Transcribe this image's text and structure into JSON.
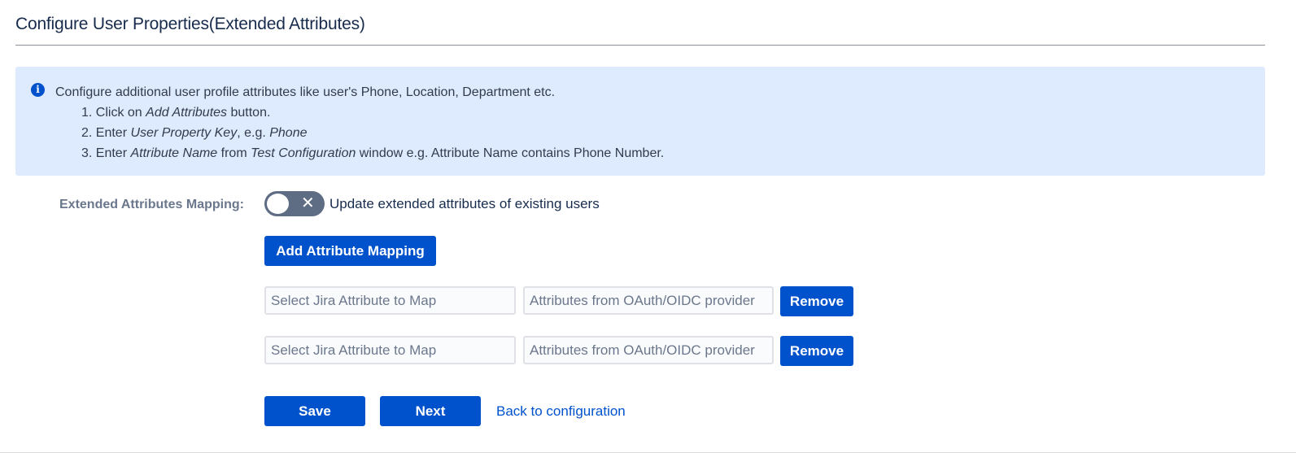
{
  "header": {
    "title": "Configure User Properties(Extended Attributes)"
  },
  "info": {
    "icon": "info-icon",
    "intro": "Configure additional user profile attributes like user's Phone, Location, Department etc.",
    "steps": [
      {
        "prefix": "1. Click on ",
        "em1": "Add Attributes",
        "mid": " button.",
        "em2": "",
        "suffix": ""
      },
      {
        "prefix": "2. Enter ",
        "em1": "User Property Key",
        "mid": ", e.g. ",
        "em2": "Phone",
        "suffix": ""
      },
      {
        "prefix": "3. Enter ",
        "em1": "Attribute Name",
        "mid": " from ",
        "em2": "Test Configuration",
        "suffix": " window e.g. Attribute Name contains Phone Number."
      }
    ]
  },
  "mapping": {
    "label": "Extended Attributes Mapping:",
    "toggle": {
      "state": "off",
      "icon": "x-icon",
      "glyph": "✕"
    },
    "toggle_caption": "Update extended attributes of existing users",
    "add_button": "Add Attribute Mapping",
    "rows": [
      {
        "jira_placeholder": "Select Jira Attribute to Map",
        "jira_value": "",
        "provider_placeholder": "Attributes from OAuth/OIDC provider",
        "provider_value": "",
        "remove_label": "Remove"
      },
      {
        "jira_placeholder": "Select Jira Attribute to Map",
        "jira_value": "",
        "provider_placeholder": "Attributes from OAuth/OIDC provider",
        "provider_value": "",
        "remove_label": "Remove"
      }
    ]
  },
  "actions": {
    "save": "Save",
    "next": "Next",
    "back_link": "Back to configuration"
  },
  "colors": {
    "primary": "#0052cc",
    "info_bg": "#deebff",
    "toggle_off": "#5e6c84"
  }
}
